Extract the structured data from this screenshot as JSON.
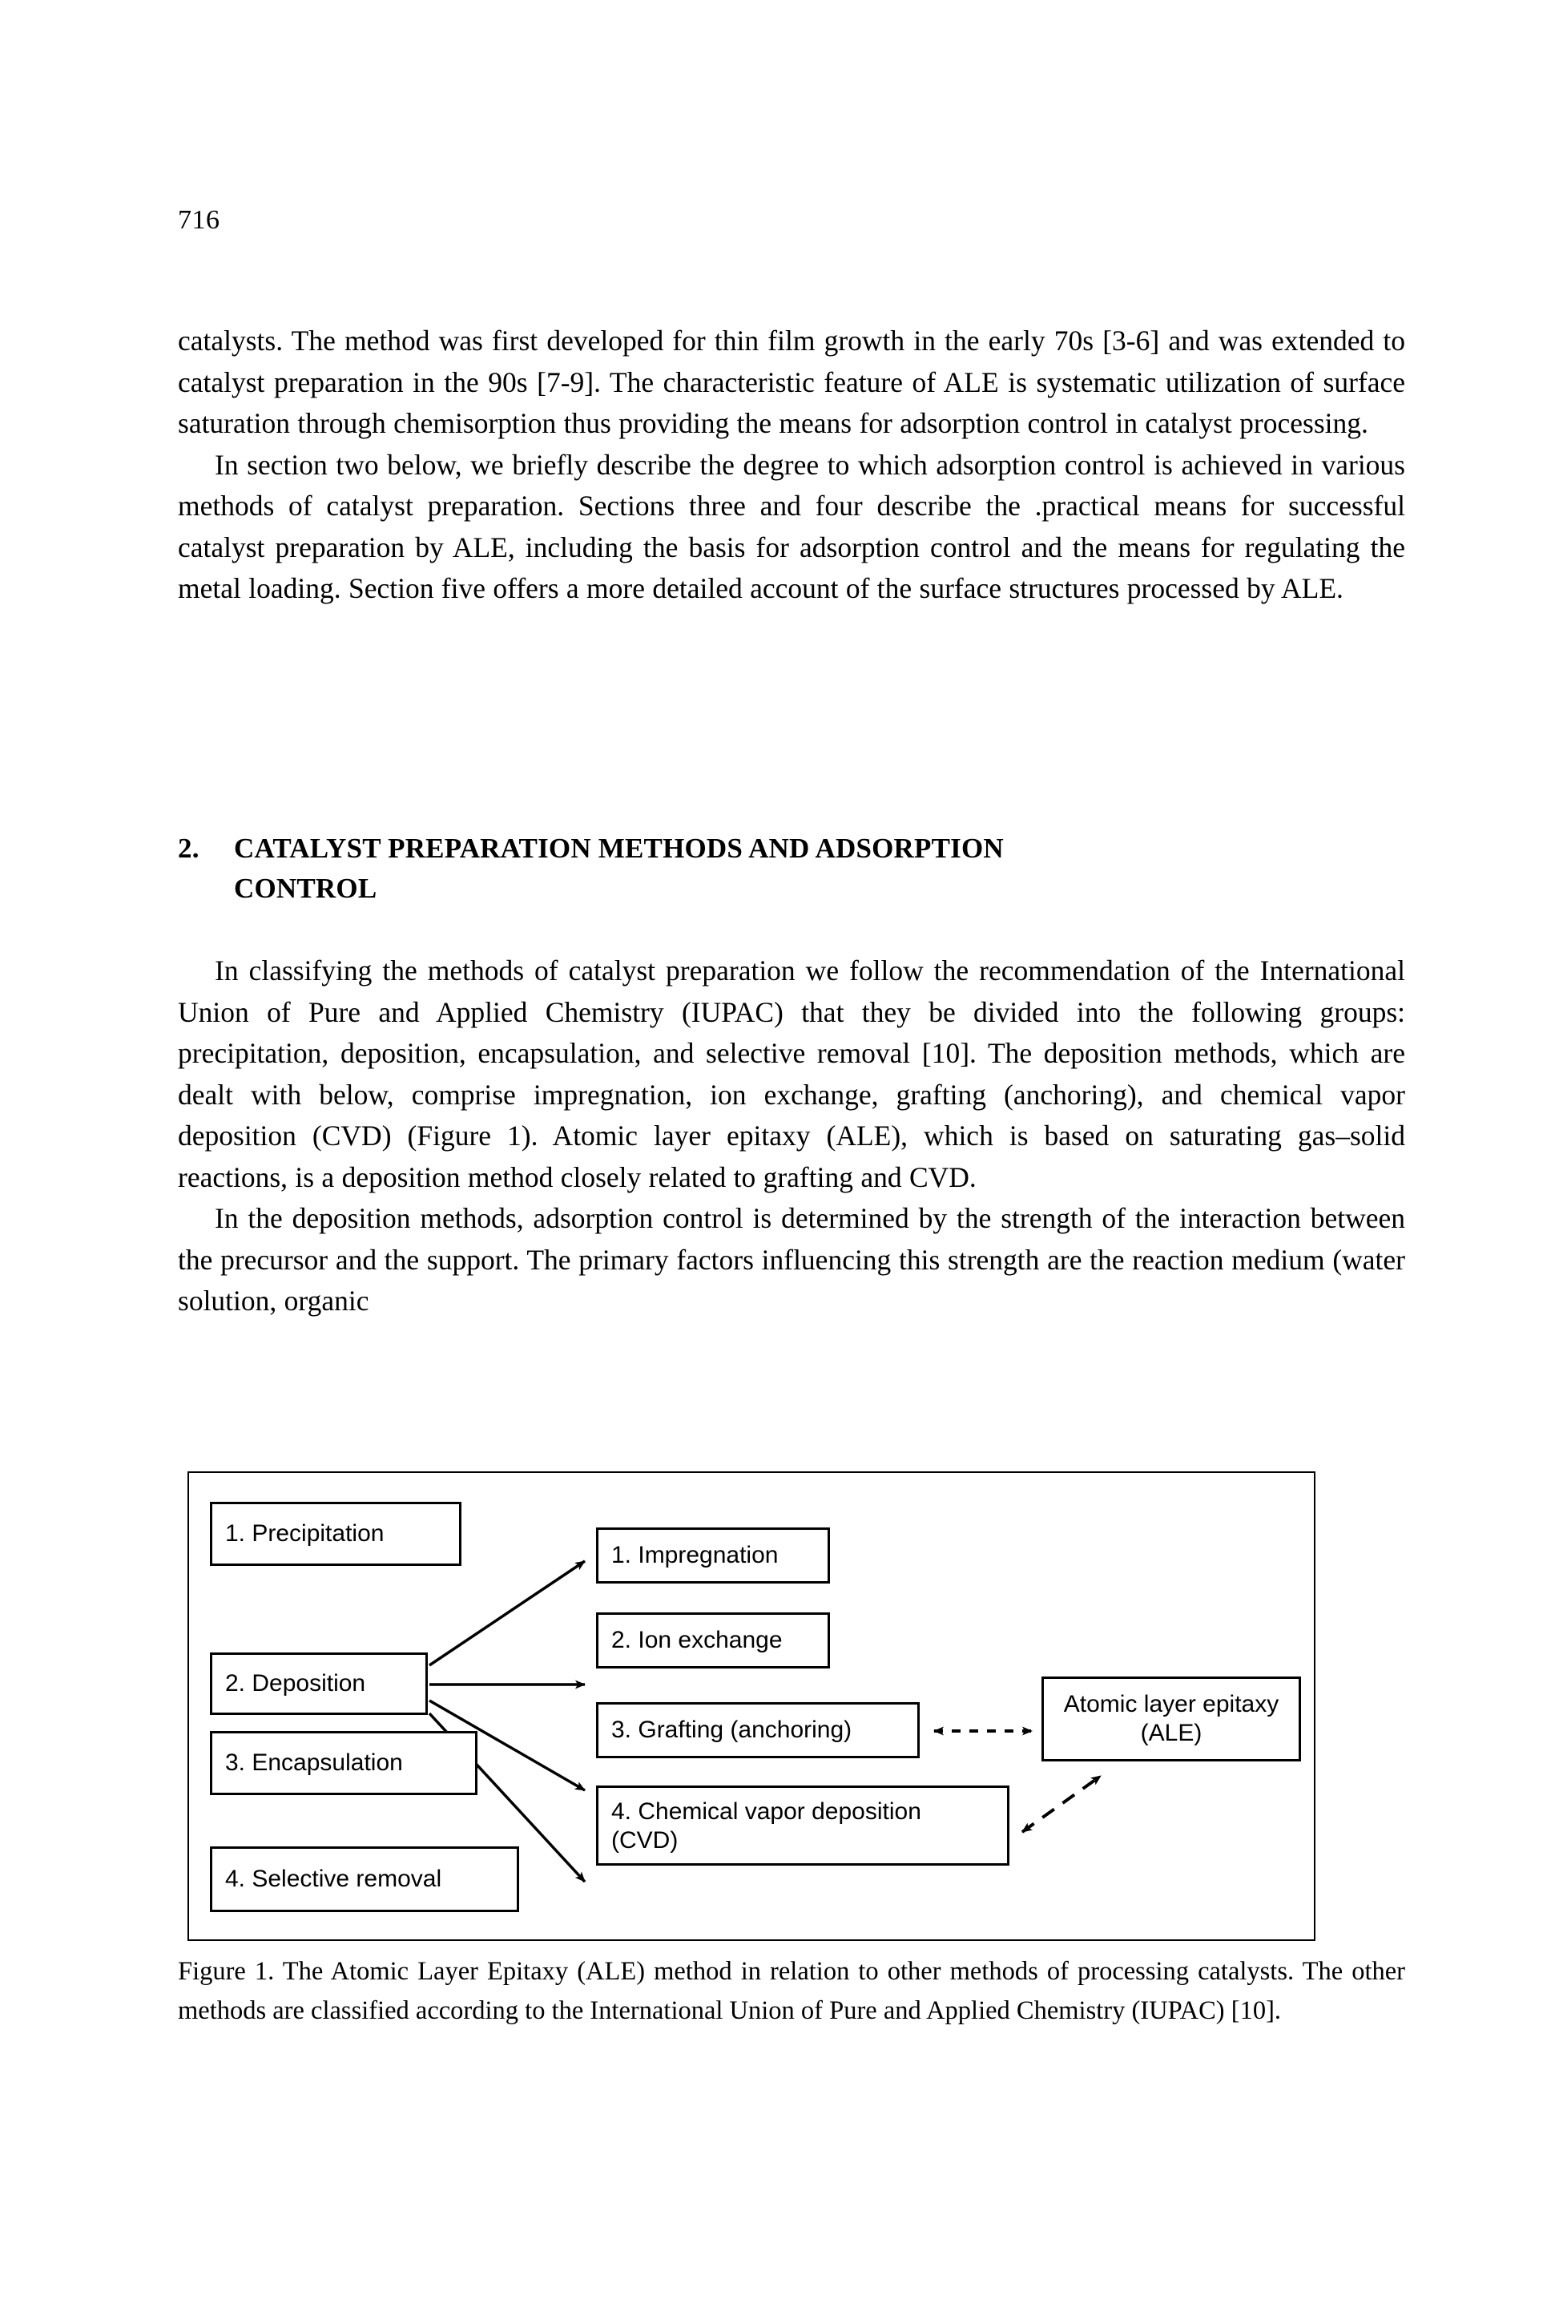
{
  "page": {
    "number": "716"
  },
  "body": {
    "paragraphs": [
      "catalysts. The method was first developed for thin film growth in the early 70s [3-6] and was extended to catalyst preparation in the 90s [7-9]. The characteristic feature of ALE is systematic utilization of surface saturation through chemisorption thus providing the means for adsorption control in catalyst processing.",
      "In section two below, we briefly describe the degree to which adsorption control is achieved in various methods of catalyst preparation. Sections three and four describe the .practical means for successful catalyst preparation by ALE, including the basis for adsorption control and the means for regulating the metal loading. Section five offers a more detailed account of the surface structures processed by ALE.",
      "In classifying the methods of catalyst preparation we follow the recommendation of the International Union of Pure and Applied Chemistry (IUPAC) that they be divided into the following groups: precipitation, deposition, encapsulation, and selective removal [10]. The deposition methods, which are dealt with below, comprise impregnation, ion exchange, grafting (anchoring), and chemical vapor deposition (CVD) (Figure 1). Atomic layer epitaxy (ALE), which is based on saturating gas–solid reactions, is a deposition method closely related to grafting and CVD.",
      "In the deposition methods, adsorption control is determined by the strength of the interaction between the precursor and the support. The primary factors influencing this strength are the reaction medium (water solution, organic"
    ]
  },
  "section": {
    "number": "2.",
    "title_line1": "CATALYST PREPARATION METHODS AND ADSORPTION",
    "title_line2": "CONTROL"
  },
  "figure": {
    "boxes": {
      "precipitation": "1. Precipitation",
      "deposition": "2. Deposition",
      "encapsulation": "3. Encapsulation",
      "selective_removal": "4. Selective removal",
      "impregnation": "1. Impregnation",
      "ion_exchange": "2. Ion exchange",
      "grafting": "3. Grafting (anchoring)",
      "cvd_line1": "4. Chemical vapor deposition",
      "cvd_line2": "(CVD)",
      "ale_line1": "Atomic layer epitaxy",
      "ale_line2": "(ALE)"
    },
    "caption": "Figure 1. The Atomic Layer Epitaxy (ALE) method in relation to other methods of processing catalysts. The other methods are classified according to the International Union of Pure and Applied Chemistry (IUPAC) [10]."
  }
}
